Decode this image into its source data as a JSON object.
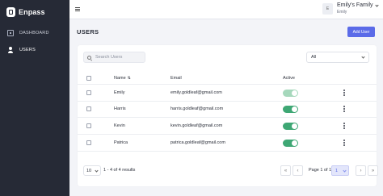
{
  "app": {
    "name": "Enpass"
  },
  "sidebar": {
    "items": [
      {
        "label": "DASHBOARD",
        "icon": "dashboard-icon"
      },
      {
        "label": "USERS",
        "icon": "users-icon"
      }
    ]
  },
  "topbar": {
    "account_name": "Emily's Family",
    "account_user": "Emily",
    "avatar_initial": "E"
  },
  "page": {
    "title": "USERS",
    "add_label": "Add User"
  },
  "search": {
    "placeholder": "Search Users"
  },
  "filter": {
    "selected": "All"
  },
  "table": {
    "columns": {
      "name": "Name",
      "email": "Email",
      "active": "Active"
    },
    "rows": [
      {
        "name": "Emily",
        "email": "emily.goldleaf@gmail.com",
        "active": true
      },
      {
        "name": "Harris",
        "email": "harris.goldleaf@gmail.com",
        "active": true
      },
      {
        "name": "Kevin",
        "email": "kevin.goldleaf@gmail.com",
        "active": true
      },
      {
        "name": "Patrica",
        "email": "patrica.goldleaf@gmail.com",
        "active": true
      }
    ]
  },
  "pagination": {
    "per_page": "10",
    "results_text": "1 - 4 of 4 results",
    "page_label": "Page 1 of 1",
    "current_page": "1",
    "first": "«",
    "prev": "‹",
    "next": "›",
    "last": "»"
  },
  "colors": {
    "sidebar": "#262a36",
    "accent": "#5b6be8",
    "toggle_on": "#3ea774"
  }
}
